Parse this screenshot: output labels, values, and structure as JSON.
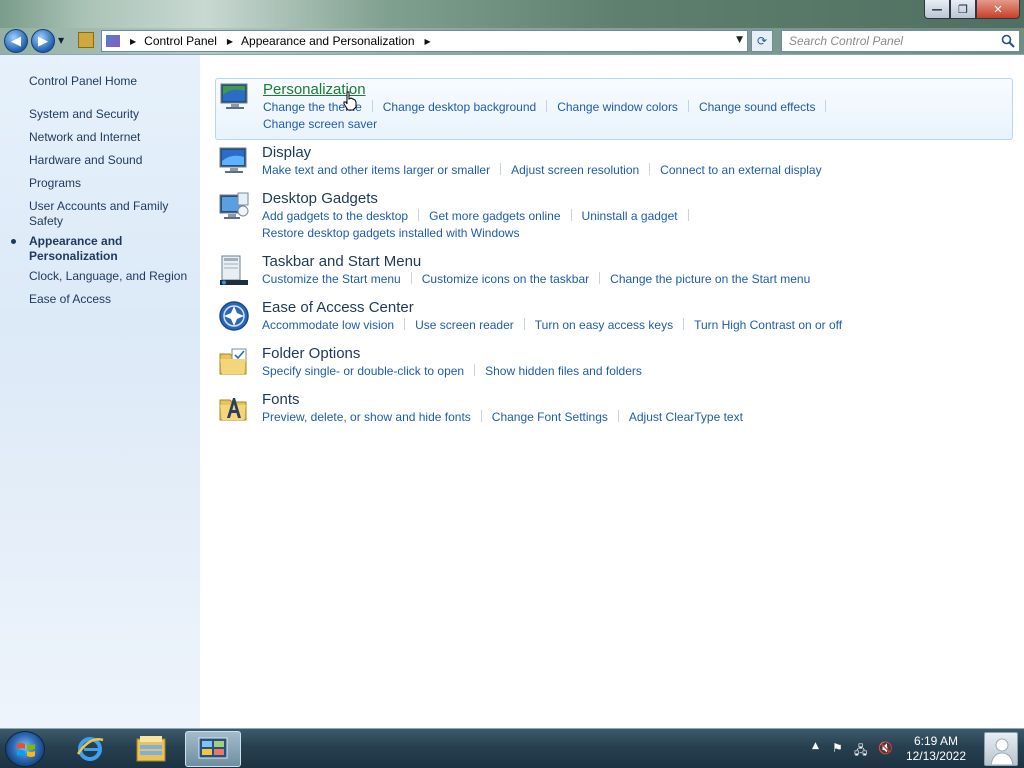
{
  "window": {
    "caption_buttons": {
      "minimize": "—",
      "restore": "❐",
      "close": "✕"
    }
  },
  "nav": {
    "back_icon": "back-arrow-icon",
    "forward_icon": "forward-arrow-icon",
    "breadcrumbs": [
      "Control Panel",
      "Appearance and Personalization"
    ],
    "search_placeholder": "Search Control Panel"
  },
  "sidebar": {
    "items": [
      {
        "label": "Control Panel Home"
      },
      {
        "label": "System and Security"
      },
      {
        "label": "Network and Internet"
      },
      {
        "label": "Hardware and Sound"
      },
      {
        "label": "Programs"
      },
      {
        "label": "User Accounts and Family Safety"
      },
      {
        "label": "Appearance and Personalization",
        "current": true
      },
      {
        "label": "Clock, Language, and Region"
      },
      {
        "label": "Ease of Access"
      }
    ]
  },
  "categories": [
    {
      "title": "Personalization",
      "icon": "personalization-icon",
      "links": [
        "Change the theme",
        "Change desktop background",
        "Change window colors",
        "Change sound effects",
        "Change screen saver"
      ]
    },
    {
      "title": "Display",
      "icon": "display-icon",
      "links": [
        "Make text and other items larger or smaller",
        "Adjust screen resolution",
        "Connect to an external display"
      ]
    },
    {
      "title": "Desktop Gadgets",
      "icon": "desktop-gadgets-icon",
      "links": [
        "Add gadgets to the desktop",
        "Get more gadgets online",
        "Uninstall a gadget",
        "Restore desktop gadgets installed with Windows"
      ]
    },
    {
      "title": "Taskbar and Start Menu",
      "icon": "taskbar-icon",
      "links": [
        "Customize the Start menu",
        "Customize icons on the taskbar",
        "Change the picture on the Start menu"
      ]
    },
    {
      "title": "Ease of Access Center",
      "icon": "ease-of-access-icon",
      "links": [
        "Accommodate low vision",
        "Use screen reader",
        "Turn on easy access keys",
        "Turn High Contrast on or off"
      ]
    },
    {
      "title": "Folder Options",
      "icon": "folder-options-icon",
      "links": [
        "Specify single- or double-click to open",
        "Show hidden files and folders"
      ]
    },
    {
      "title": "Fonts",
      "icon": "fonts-icon",
      "links": [
        "Preview, delete, or show and hide fonts",
        "Change Font Settings",
        "Adjust ClearType text"
      ]
    }
  ],
  "taskbar": {
    "clock_time": "6:19 AM",
    "clock_date": "12/13/2022",
    "pinned": [
      "internet-explorer-icon",
      "windows-explorer-icon",
      "control-panel-icon"
    ]
  }
}
